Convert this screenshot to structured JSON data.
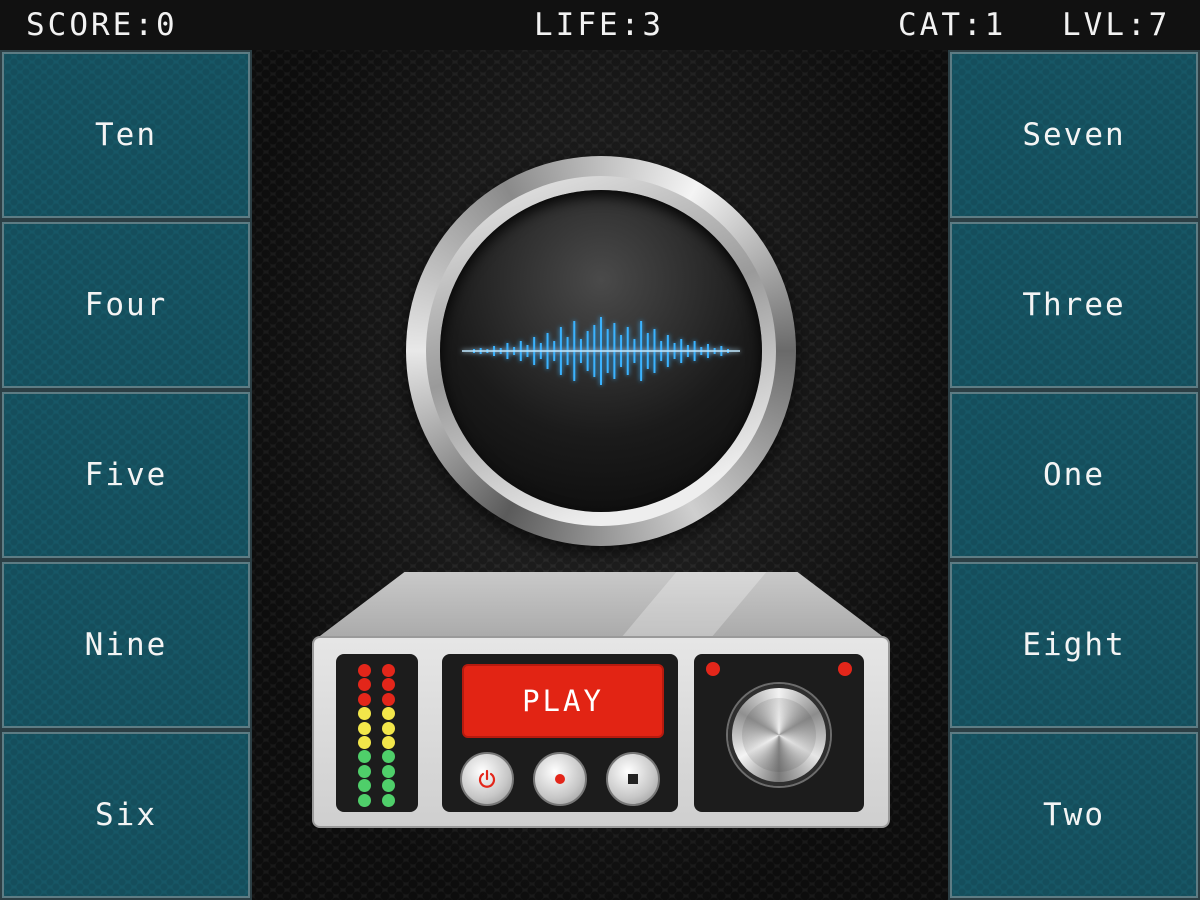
{
  "hud": {
    "score": "SCORE:0",
    "life": "LIFE:3",
    "cat": "CAT:1",
    "lvl": "LVL:7"
  },
  "answers_left": [
    "Ten",
    "Four",
    "Five",
    "Nine",
    "Six"
  ],
  "answers_right": [
    "Seven",
    "Three",
    "One",
    "Eight",
    "Two"
  ],
  "player": {
    "play_label": "PLAY",
    "buttons": [
      "power-icon",
      "record-icon",
      "stop-icon"
    ]
  },
  "colors": {
    "tile": "#175766",
    "play": "#e22414",
    "wave": "#3ab3ff",
    "led_red": "#e3261a",
    "led_yellow": "#f2e64a",
    "led_green": "#4fcf6a"
  }
}
